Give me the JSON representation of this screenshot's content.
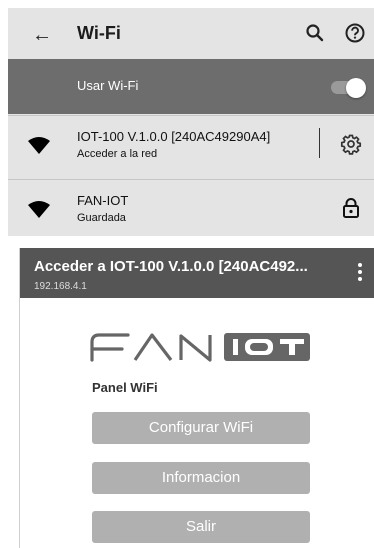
{
  "settings": {
    "title": "Wi-Fi",
    "use_wifi_label": "Usar Wi-Fi",
    "use_wifi_enabled": true,
    "networks": [
      {
        "name": "IOT-100 V.1.0.0 [240AC49290A4]",
        "status": "Acceder a la red",
        "action_icon": "gear-icon"
      },
      {
        "name": "FAN-IOT",
        "status": "Guardada",
        "action_icon": "lock-icon"
      }
    ]
  },
  "portal": {
    "title": "Acceder a IOT-100 V.1.0.0 [240AC492...",
    "address": "192.168.4.1",
    "logo_text": "FAN IOT",
    "panel_title": "Panel WiFi",
    "buttons": [
      "Configurar WiFi",
      "Informacion",
      "Salir"
    ]
  },
  "colors": {
    "toolbar": "#e4e4e4",
    "use_wifi_bar": "#6d6d6d",
    "portal_header": "#555555",
    "button": "#b0b0b0"
  }
}
